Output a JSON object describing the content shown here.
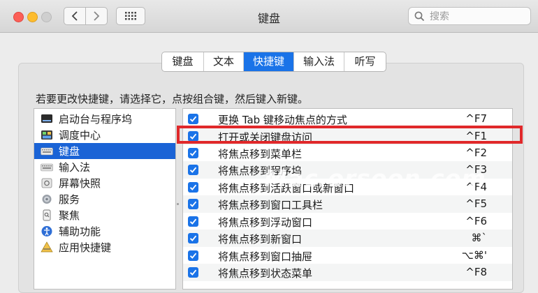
{
  "window": {
    "title": "键盘"
  },
  "search": {
    "placeholder": "搜索",
    "value": ""
  },
  "tabs": [
    {
      "label": "键盘",
      "active": false
    },
    {
      "label": "文本",
      "active": false
    },
    {
      "label": "快捷键",
      "active": true
    },
    {
      "label": "输入法",
      "active": false
    },
    {
      "label": "听写",
      "active": false
    }
  ],
  "instruction": "若要更改快捷键，请选择它，点按组合键，然后键入新键。",
  "sidebar": {
    "items": [
      {
        "label": "启动台与程序坞",
        "icon": "launchpad-dock-icon",
        "selected": false
      },
      {
        "label": "调度中心",
        "icon": "mission-control-icon",
        "selected": false
      },
      {
        "label": "键盘",
        "icon": "keyboard-icon",
        "selected": true
      },
      {
        "label": "输入法",
        "icon": "input-sources-icon",
        "selected": false
      },
      {
        "label": "屏幕快照",
        "icon": "screenshot-icon",
        "selected": false
      },
      {
        "label": "服务",
        "icon": "services-gear-icon",
        "selected": false
      },
      {
        "label": "聚焦",
        "icon": "spotlight-icon",
        "selected": false
      },
      {
        "label": "辅助功能",
        "icon": "accessibility-icon",
        "selected": false
      },
      {
        "label": "应用快捷键",
        "icon": "app-shortcuts-icon",
        "selected": false
      }
    ]
  },
  "shortcuts": {
    "rows": [
      {
        "label": "更换 Tab 键移动焦点的方式",
        "key": "^F7",
        "checked": true
      },
      {
        "label": "打开或关闭键盘访问",
        "key": "^F1",
        "checked": true
      },
      {
        "label": "将焦点移到菜单栏",
        "key": "^F2",
        "checked": true
      },
      {
        "label": "将焦点移到程序坞",
        "key": "^F3",
        "checked": true
      },
      {
        "label": "将焦点移到活跃窗口或新窗口",
        "key": "^F4",
        "checked": true
      },
      {
        "label": "将焦点移到窗口工具栏",
        "key": "^F5",
        "checked": true
      },
      {
        "label": "将焦点移到浮动窗口",
        "key": "^F6",
        "checked": true
      },
      {
        "label": "将焦点移到新窗口",
        "key": "⌘`",
        "checked": true
      },
      {
        "label": "将焦点移到窗口抽屉",
        "key": "⌥⌘'",
        "checked": true
      },
      {
        "label": "将焦点移到状态菜单",
        "key": "^F8",
        "checked": true
      }
    ]
  },
  "watermark": "Mac.orsoon.com",
  "colors": {
    "accent": "#1a73e8",
    "selection": "#1a63d6",
    "highlight_box": "#e0282a"
  }
}
